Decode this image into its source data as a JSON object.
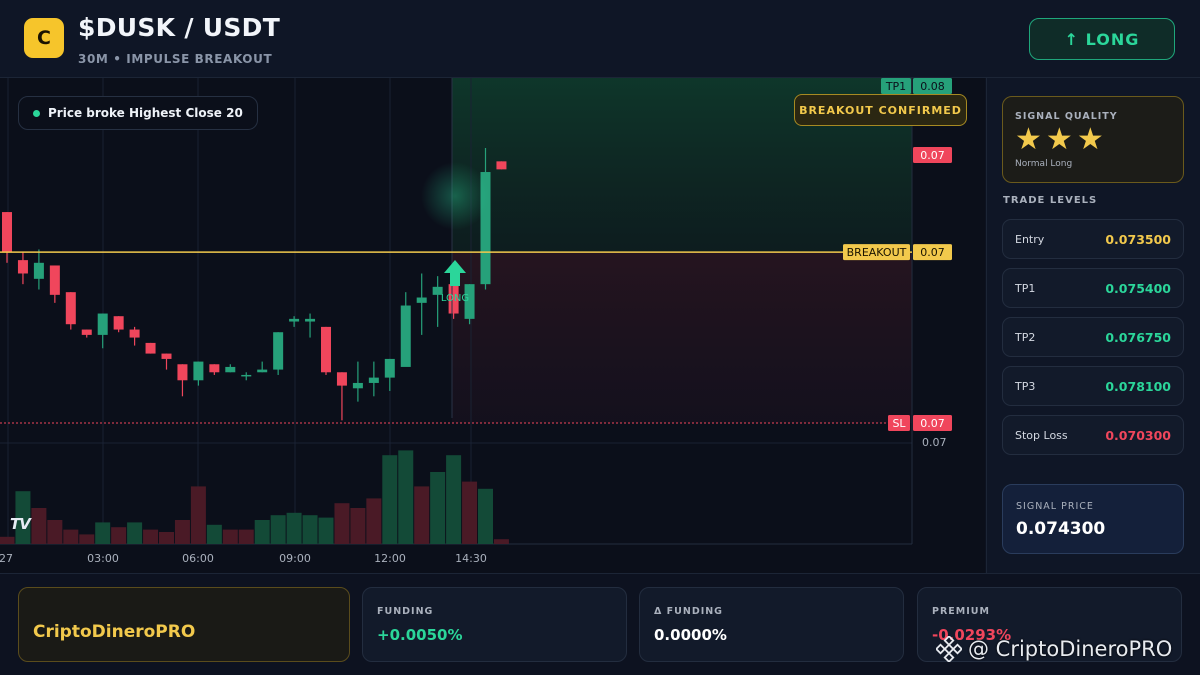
{
  "header": {
    "logo_letter": "C",
    "pair": "$DUSK / USDT",
    "subtitle": "30M • IMPULSE BREAKOUT",
    "long_button": "↑ LONG"
  },
  "chart": {
    "badge_broke": "Price broke Highest Close 20",
    "badge_breakout": "BREAKOUT CONFIRMED",
    "long_marker_label": "LONG",
    "tradingview_logo": "TV",
    "time_labels": [
      "27",
      "03:00",
      "06:00",
      "09:00",
      "12:00",
      "14:30"
    ],
    "price_tags": {
      "tp1_label": "TP1",
      "tp1_value": "0.08",
      "current_value": "0.07",
      "breakout_label": "BREAKOUT",
      "breakout_value": "0.07",
      "sl_label": "SL",
      "sl_value": "0.07",
      "axis_value": "0.07"
    },
    "colors": {
      "up": "#26a17a",
      "down": "#f0465c",
      "breakout_line": "#f2c94c",
      "sl_line": "#f0465c"
    }
  },
  "chart_data": {
    "type": "candlestick",
    "price_levels": {
      "tp1": 0.0754,
      "breakout": 0.0735,
      "stop_loss": 0.0703
    },
    "candles": [
      {
        "o": 0.07425,
        "h": 0.07425,
        "c": 0.0735,
        "l": 0.0733
      },
      {
        "o": 0.07335,
        "h": 0.0735,
        "c": 0.0731,
        "l": 0.0729
      },
      {
        "o": 0.073,
        "h": 0.07355,
        "c": 0.0733,
        "l": 0.0728
      },
      {
        "o": 0.07325,
        "h": 0.07325,
        "c": 0.0727,
        "l": 0.07255
      },
      {
        "o": 0.07275,
        "h": 0.07275,
        "c": 0.07215,
        "l": 0.07205
      },
      {
        "o": 0.07205,
        "h": 0.07205,
        "c": 0.07195,
        "l": 0.0719
      },
      {
        "o": 0.07195,
        "h": 0.07235,
        "c": 0.07235,
        "l": 0.0717
      },
      {
        "o": 0.0723,
        "h": 0.0723,
        "c": 0.07205,
        "l": 0.072
      },
      {
        "o": 0.07205,
        "h": 0.0721,
        "c": 0.0719,
        "l": 0.07175
      },
      {
        "o": 0.0718,
        "h": 0.0718,
        "c": 0.0716,
        "l": 0.0716
      },
      {
        "o": 0.0716,
        "h": 0.0716,
        "c": 0.0715,
        "l": 0.0713
      },
      {
        "o": 0.0714,
        "h": 0.0714,
        "c": 0.0711,
        "l": 0.0708
      },
      {
        "o": 0.0711,
        "h": 0.07145,
        "c": 0.07145,
        "l": 0.071
      },
      {
        "o": 0.0714,
        "h": 0.0714,
        "c": 0.07125,
        "l": 0.0712
      },
      {
        "o": 0.07125,
        "h": 0.0714,
        "c": 0.07135,
        "l": 0.07125
      },
      {
        "o": 0.0712,
        "h": 0.07125,
        "c": 0.0712,
        "l": 0.0711
      },
      {
        "o": 0.07125,
        "h": 0.07145,
        "c": 0.0713,
        "l": 0.07125
      },
      {
        "o": 0.0713,
        "h": 0.072,
        "c": 0.072,
        "l": 0.0712
      },
      {
        "o": 0.0722,
        "h": 0.0723,
        "c": 0.07225,
        "l": 0.0721
      },
      {
        "o": 0.0722,
        "h": 0.07235,
        "c": 0.07225,
        "l": 0.0719
      },
      {
        "o": 0.0721,
        "h": 0.0721,
        "c": 0.07125,
        "l": 0.0712
      },
      {
        "o": 0.07125,
        "h": 0.07125,
        "c": 0.071,
        "l": 0.07035
      },
      {
        "o": 0.07095,
        "h": 0.07145,
        "c": 0.07105,
        "l": 0.0707
      },
      {
        "o": 0.07105,
        "h": 0.07145,
        "c": 0.07115,
        "l": 0.0708
      },
      {
        "o": 0.07115,
        "h": 0.0715,
        "c": 0.0715,
        "l": 0.0709
      },
      {
        "o": 0.07135,
        "h": 0.07275,
        "c": 0.0725,
        "l": 0.07145
      },
      {
        "o": 0.07255,
        "h": 0.0731,
        "c": 0.07265,
        "l": 0.07195
      },
      {
        "o": 0.0727,
        "h": 0.07305,
        "c": 0.07285,
        "l": 0.0721
      },
      {
        "o": 0.0729,
        "h": 0.0729,
        "c": 0.07235,
        "l": 0.07225
      },
      {
        "o": 0.07225,
        "h": 0.0729,
        "c": 0.0729,
        "l": 0.07215
      },
      {
        "o": 0.0729,
        "h": 0.07545,
        "c": 0.075,
        "l": 0.0728
      },
      {
        "o": 0.0752,
        "h": 0.0752,
        "c": 0.07505,
        "l": 0.07505
      }
    ],
    "volumes": [
      3,
      22,
      15,
      10,
      6,
      4,
      9,
      7,
      9,
      6,
      5,
      10,
      24,
      8,
      6,
      6,
      10,
      12,
      13,
      12,
      11,
      17,
      15,
      19,
      37,
      39,
      24,
      30,
      37,
      26,
      23,
      2
    ],
    "volume_colors": [
      "down",
      "up",
      "down",
      "down",
      "down",
      "down",
      "up",
      "down",
      "up",
      "down",
      "down",
      "down",
      "down",
      "up",
      "down",
      "down",
      "up",
      "up",
      "up",
      "up",
      "up",
      "down",
      "down",
      "down",
      "up",
      "up",
      "down",
      "up",
      "up",
      "down",
      "up",
      "down"
    ],
    "x_ticks": [
      "27",
      "03:00",
      "06:00",
      "09:00",
      "12:00",
      "14:30"
    ]
  },
  "sidebar": {
    "signal_quality_label": "SIGNAL QUALITY",
    "stars": 3,
    "star_glyph": "★",
    "signal_quality_desc": "Normal Long",
    "trade_levels_title": "TRADE LEVELS",
    "levels": [
      {
        "label": "Entry",
        "value": "0.073500",
        "color": "#f2c94c"
      },
      {
        "label": "TP1",
        "value": "0.075400",
        "color": "#2bd69a"
      },
      {
        "label": "TP2",
        "value": "0.076750",
        "color": "#2bd69a"
      },
      {
        "label": "TP3",
        "value": "0.078100",
        "color": "#2bd69a"
      },
      {
        "label": "Stop Loss",
        "value": "0.070300",
        "color": "#f0465c"
      }
    ],
    "signal_price_label": "SIGNAL PRICE",
    "signal_price_value": "0.074300"
  },
  "footer": {
    "brand": "CriptoDineroPRO",
    "funding_label": "FUNDING",
    "funding_value": "+0.0050%",
    "delta_label": "Δ FUNDING",
    "delta_value": "0.0000%",
    "premium_label": "PREMIUM",
    "premium_value": "-0.0293%",
    "watermark": "@ CriptoDineroPRO"
  }
}
